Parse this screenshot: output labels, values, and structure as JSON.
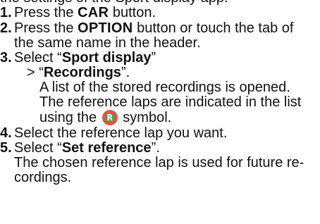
{
  "top_cut_text": "the settings of the Sport display app.",
  "steps": [
    {
      "num": "1.",
      "pre": "Press the ",
      "key": "CAR",
      "post": " button."
    },
    {
      "num": "2.",
      "pre": "Press the ",
      "key": "OPTION",
      "post": " button or touch the tab of",
      "line2": "the same name in the header."
    },
    {
      "num": "3.",
      "pre": "Select “",
      "bold": "Sport display",
      "post": "”",
      "sub_pre": "> “",
      "sub_bold": "Recordings",
      "sub_post": "”.",
      "desc1": "A list of the stored recordings is opened.",
      "desc2": "The reference laps are indicated in the list",
      "desc3_pre": "using the ",
      "desc3_post": " symbol."
    },
    {
      "num": "4.",
      "text": "Select the reference lap you want."
    },
    {
      "num": "5.",
      "pre": "Select “",
      "bold": "Set reference",
      "post": "”.",
      "desc1": "The chosen reference lap is used for future re-",
      "desc2": "cordings."
    }
  ],
  "icons": {
    "reference_symbol": "R",
    "reference_symbol_color": "#e4553f"
  }
}
